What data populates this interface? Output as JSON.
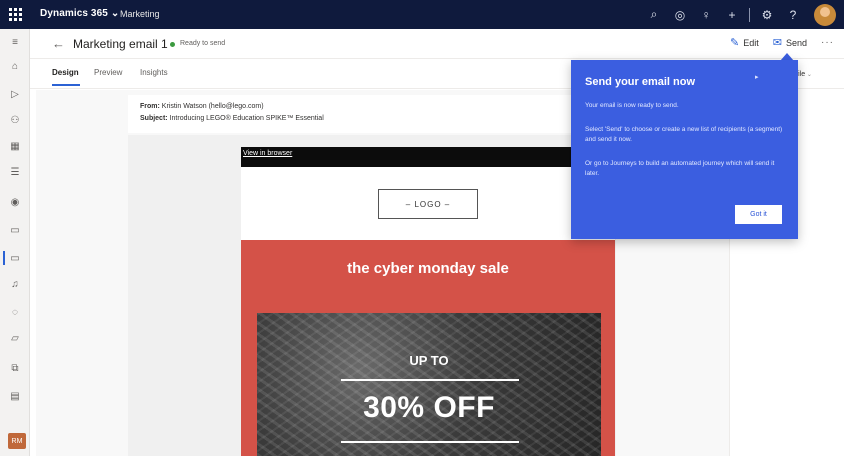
{
  "topbar": {
    "app_title": "Dynamics 365",
    "chevron": "⌄",
    "app_area": "Marketing",
    "icons": [
      "search-icon",
      "target-icon",
      "lightbulb-icon",
      "plus-icon",
      "gear-icon",
      "help-icon"
    ],
    "icon_glyphs": [
      "⌕",
      "◎",
      "♀",
      "+",
      "⚙",
      "?"
    ]
  },
  "leftnav": {
    "items": [
      "menu-icon",
      "home-icon",
      "play-icon",
      "people-icon",
      "building-icon",
      "list-icon",
      "globe-icon",
      "folder-icon",
      "email-icon",
      "bell-icon",
      "gear-icon",
      "chat-icon",
      "library-icon",
      "page-icon"
    ],
    "glyphs": [
      "≡",
      "⌂",
      "▷",
      "⚇",
      "▦",
      "☰",
      "◉",
      "▭",
      "▭",
      "♫",
      "◌",
      "▱",
      "⧉",
      "▤"
    ],
    "user_initials": "RM"
  },
  "cmdbar": {
    "back_glyph": "←",
    "title": "Marketing email 1",
    "status": "Ready to send",
    "edit_label": "Edit",
    "send_label": "Send",
    "edit_glyph": "✎",
    "send_glyph": "✉",
    "more_glyph": "···"
  },
  "tabs": [
    {
      "label": "Design"
    },
    {
      "label": "Preview"
    },
    {
      "label": "Insights"
    }
  ],
  "profile_fragment": {
    "small": "ew",
    "label": "rofile",
    "chevron": "⌄"
  },
  "email_meta": {
    "from_label": "From:",
    "from_value": "Kristin Watson (hello@lego.com)",
    "subject_label": "Subject:",
    "subject_value": "Introducing LEGO® Education SPIKE™ Essential"
  },
  "email": {
    "view_in_browser": "View in browser",
    "logo": "– LOGO –",
    "promo_title": "the cyber monday sale",
    "up_to": "UP TO",
    "discount": "30% OFF"
  },
  "popup": {
    "title": "Send your email now",
    "close_glyph": "▸",
    "p1": "Your email is now ready to send.",
    "p2": "Select 'Send' to choose or create a new list of recipients (a segment) and send it now.",
    "p3": "Or go to Journeys to build an automated journey which will send it later.",
    "button": "Got it"
  },
  "colors": {
    "topbar": "#0f1a3d",
    "accent": "#2b62d4",
    "popup": "#3b5ee0",
    "promo": "#d45248",
    "status_ok": "#3c9a3f"
  }
}
